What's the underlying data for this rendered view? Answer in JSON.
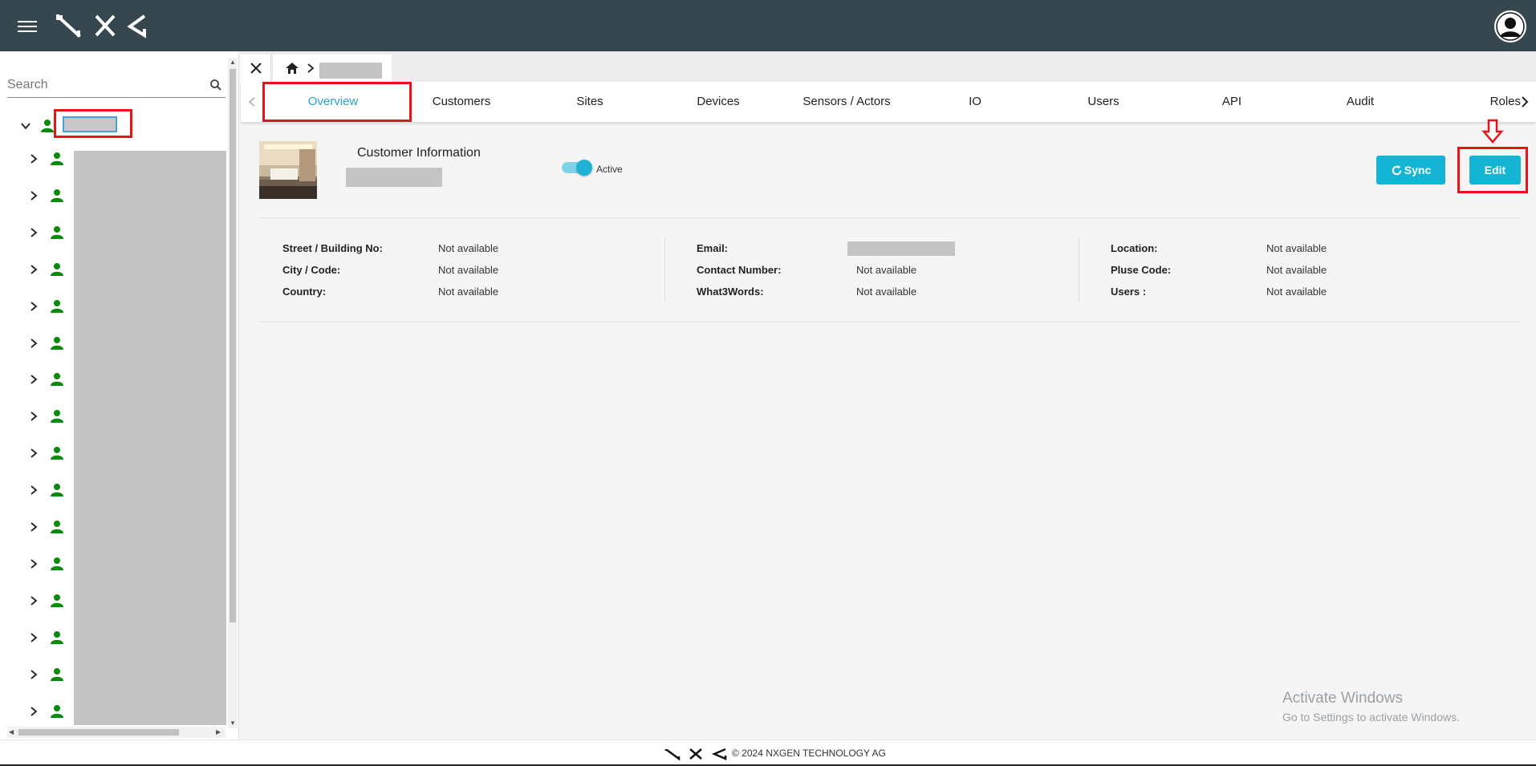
{
  "header": {
    "logo_icon": "nxg-logo",
    "menu_icon": "hamburger-menu-icon",
    "avatar_icon": "user-avatar-icon"
  },
  "sidebar": {
    "search_placeholder": "Search",
    "tree_item_count": 16,
    "colors": {
      "person_icon": "#0a8a0a",
      "highlight": "#e8121a"
    }
  },
  "breadcrumb": {
    "home_icon": "home-icon"
  },
  "tabs": [
    {
      "label": "Overview",
      "active": true
    },
    {
      "label": "Customers"
    },
    {
      "label": "Sites"
    },
    {
      "label": "Devices"
    },
    {
      "label": "Sensors / Actors"
    },
    {
      "label": "IO"
    },
    {
      "label": "Users"
    },
    {
      "label": "API"
    },
    {
      "label": "Audit"
    },
    {
      "label": "Roles"
    }
  ],
  "customer": {
    "title": "Customer Information",
    "status_label": "Active",
    "status_active": true,
    "sync_label": "Sync",
    "edit_label": "Edit"
  },
  "info": {
    "col1": [
      {
        "label": "Street / Building No:",
        "value": "Not available"
      },
      {
        "label": "City / Code:",
        "value": "Not available"
      },
      {
        "label": "Country:",
        "value": "Not available"
      }
    ],
    "col2": [
      {
        "label": "Email:",
        "value": ""
      },
      {
        "label": "Contact Number:",
        "value": "Not available"
      },
      {
        "label": "What3Words:",
        "value": "Not available"
      }
    ],
    "col3": [
      {
        "label": "Location:",
        "value": "Not available"
      },
      {
        "label": "Pluse Code:",
        "value": "Not available"
      },
      {
        "label": "Users :",
        "value": "Not available"
      }
    ]
  },
  "watermark": {
    "line1": "Activate Windows",
    "line2": "Go to Settings to activate Windows."
  },
  "footer": {
    "text": "© 2024 NXGEN TECHNOLOGY AG"
  },
  "colors": {
    "topbar": "#37474f",
    "accent": "#14b4d4",
    "active_tab": "#26a3c8",
    "annotation_red": "#e8121a"
  }
}
